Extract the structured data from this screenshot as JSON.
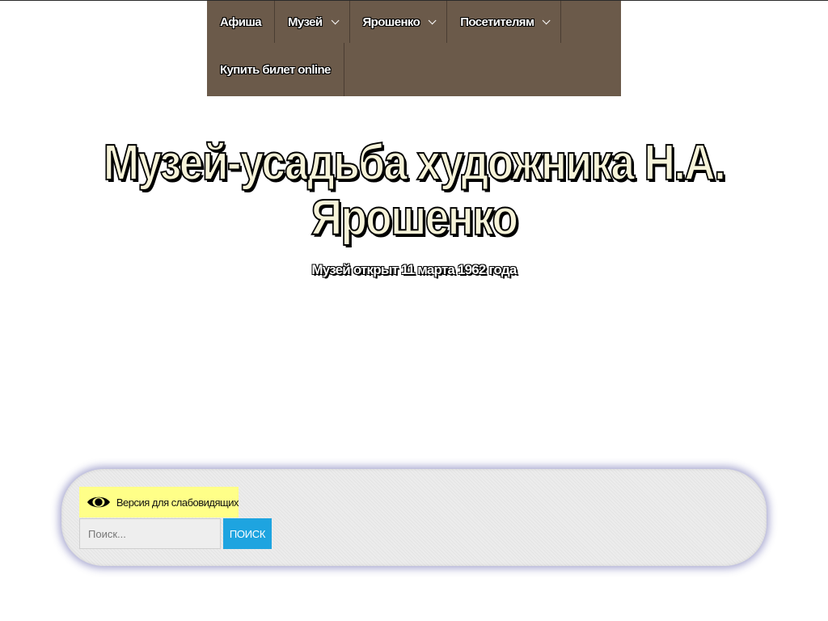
{
  "nav": {
    "items": [
      {
        "label": "Афиша",
        "has_submenu": false
      },
      {
        "label": "Музей",
        "has_submenu": true
      },
      {
        "label": "Ярошенко",
        "has_submenu": true
      },
      {
        "label": "Посетителям",
        "has_submenu": true
      },
      {
        "label": "Купить билет online",
        "has_submenu": false
      }
    ]
  },
  "header": {
    "title_line1": "Музей-усадьба художника Н.А.",
    "title_line2": "Ярошенко",
    "subtitle": "Музей открыт 11 марта 1962 года"
  },
  "accessibility": {
    "label": "Версия для слабовидящих",
    "icon": "eye-icon"
  },
  "search": {
    "placeholder": "Поиск...",
    "value": "",
    "button_label": "ПОИСК"
  },
  "colors": {
    "nav_bg": "#6b5a4a",
    "title_fill": "#f6f3d9",
    "accessibility_bg": "#ffff88",
    "search_button": "#1ea4e0"
  }
}
